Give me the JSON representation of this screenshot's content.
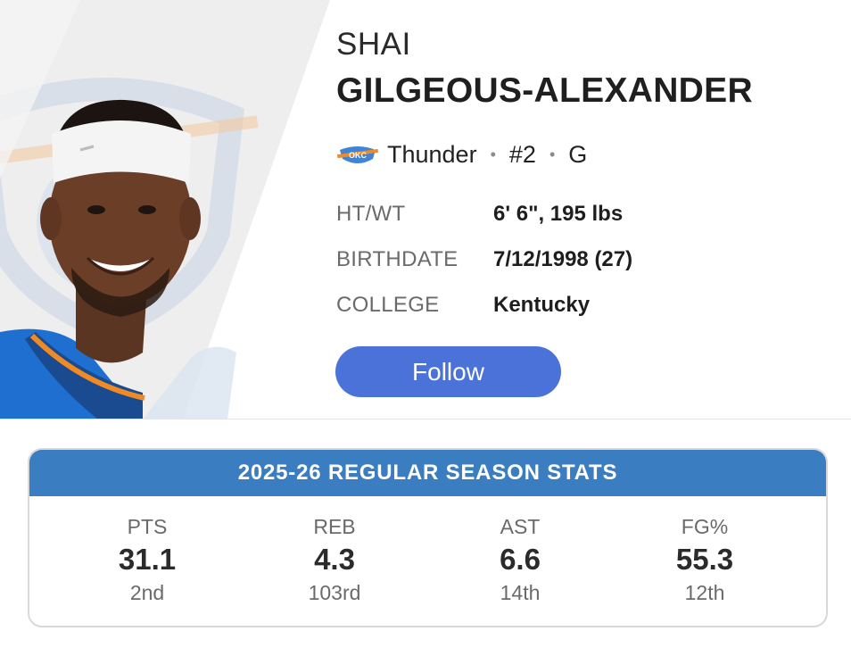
{
  "player": {
    "first_name": "SHAI",
    "last_name": "GILGEOUS-ALEXANDER",
    "team": "Thunder",
    "number": "#2",
    "position": "G",
    "separator": "•",
    "team_logo_icon": "thunder-logo-icon"
  },
  "info": [
    {
      "label": "HT/WT",
      "value": "6' 6\", 195 lbs"
    },
    {
      "label": "BIRTHDATE",
      "value": "7/12/1998 (27)"
    },
    {
      "label": "COLLEGE",
      "value": "Kentucky"
    }
  ],
  "follow_button": {
    "label": "Follow"
  },
  "stats": {
    "title": "2025-26 REGULAR SEASON STATS",
    "items": [
      {
        "label": "PTS",
        "value": "31.1",
        "rank": "2nd"
      },
      {
        "label": "REB",
        "value": "4.3",
        "rank": "103rd"
      },
      {
        "label": "AST",
        "value": "6.6",
        "rank": "14th"
      },
      {
        "label": "FG%",
        "value": "55.3",
        "rank": "12th"
      }
    ]
  },
  "colors": {
    "follow_button": "#4a72d9",
    "stats_header": "#3a7dc0",
    "jersey_blue": "#1f6fd1",
    "jersey_orange": "#f08a24"
  }
}
